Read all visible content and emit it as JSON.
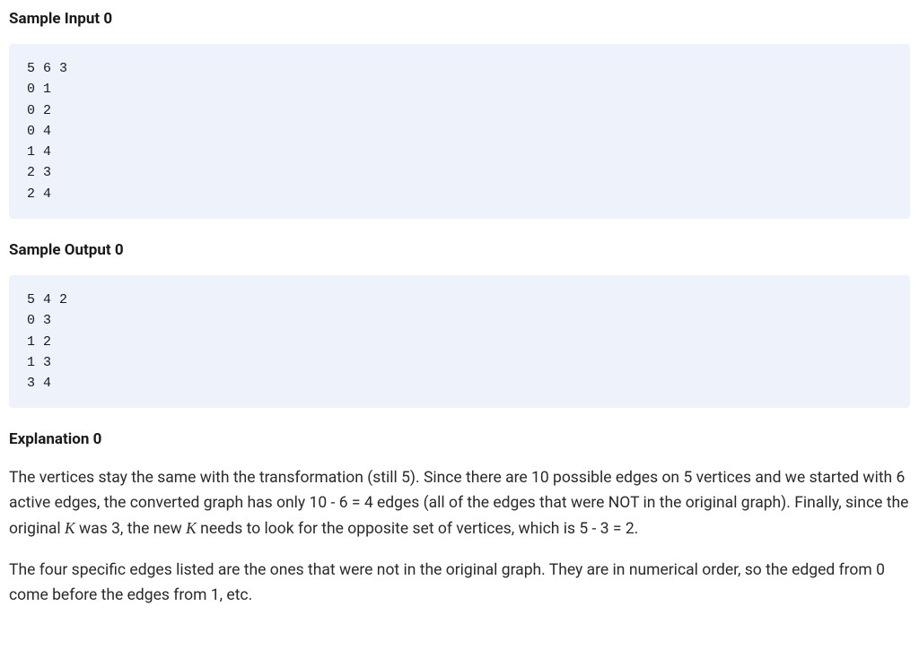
{
  "sections": {
    "sampleInput": {
      "heading": "Sample Input 0",
      "content": "5 6 3\n0 1\n0 2\n0 4\n1 4\n2 3\n2 4"
    },
    "sampleOutput": {
      "heading": "Sample Output 0",
      "content": "5 4 2\n0 3\n1 2\n1 3\n3 4"
    },
    "explanation": {
      "heading": "Explanation 0",
      "para1_a": "The vertices stay the same with the transformation (still 5). Since there are 10 possible edges on 5 vertices and we started with 6 active edges, the converted graph has only 10 - 6 = 4 edges (all of the edges that were NOT in the original graph). Finally, since the original ",
      "k1": "K",
      "para1_b": " was 3, the new ",
      "k2": "K",
      "para1_c": " needs to look for the opposite set of vertices, which is 5 - 3 = 2.",
      "para2": "The four specific edges listed are the ones that were not in the original graph. They are in numerical order, so the edged from 0 come before the edges from 1, etc."
    }
  }
}
